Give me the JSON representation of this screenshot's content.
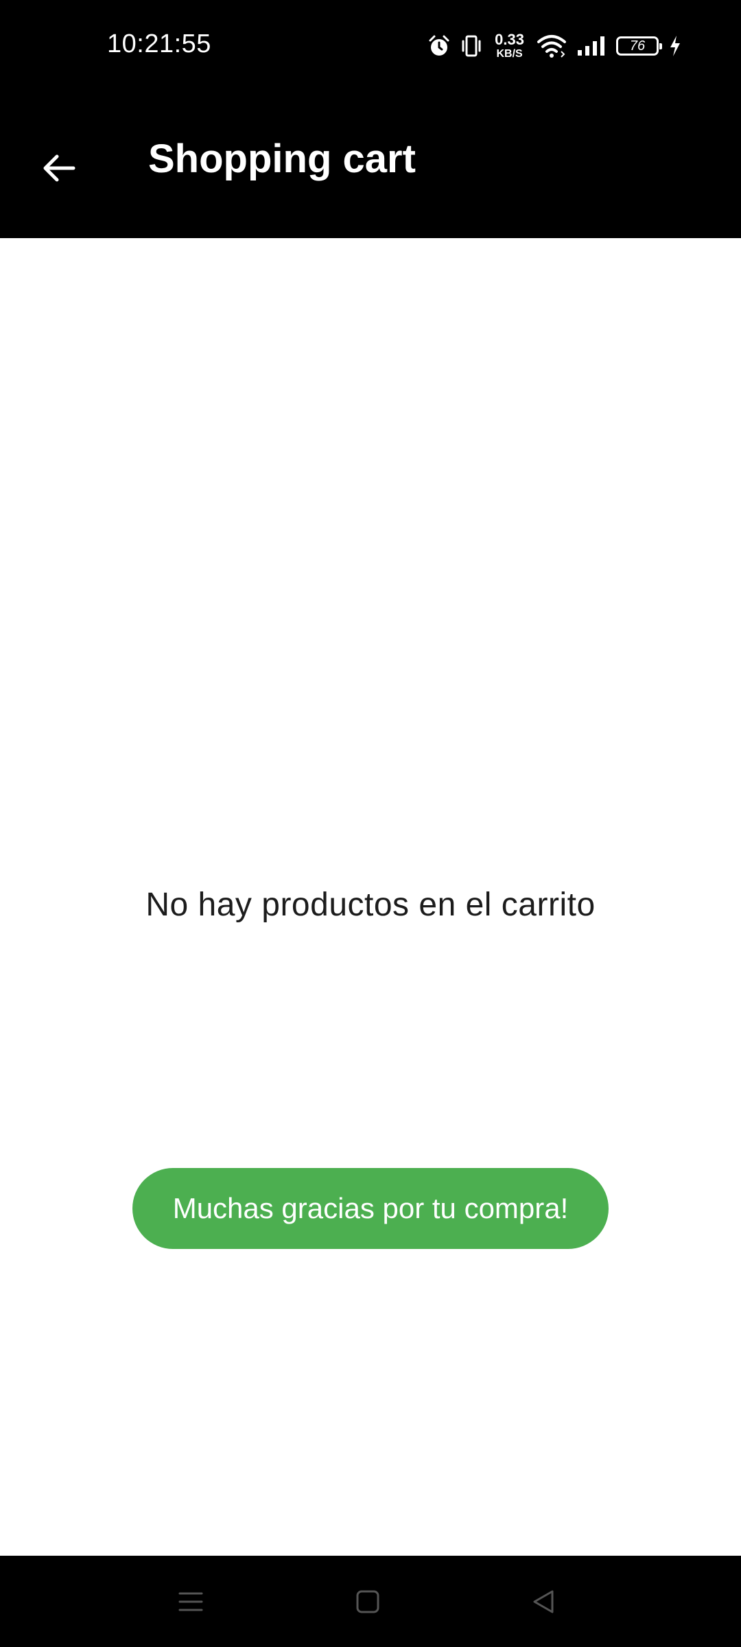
{
  "status_bar": {
    "time": "10:21:55",
    "net_speed_value": "0.33",
    "net_speed_unit": "KB/S",
    "battery_level": "76",
    "icons": [
      "alarm-icon",
      "vibrate-icon",
      "wifi-icon",
      "signal-icon",
      "battery-icon",
      "charging-icon"
    ]
  },
  "app_bar": {
    "title": "Shopping cart",
    "back_icon": "arrow-back-icon",
    "background": "#000000"
  },
  "cart": {
    "empty_message": "No hay productos en el carrito"
  },
  "toast": {
    "message": "Muchas gracias por tu compra!",
    "color": "#4caf50"
  },
  "nav_bar": {
    "icons": [
      "menu-icon",
      "home-icon",
      "back-icon"
    ]
  }
}
